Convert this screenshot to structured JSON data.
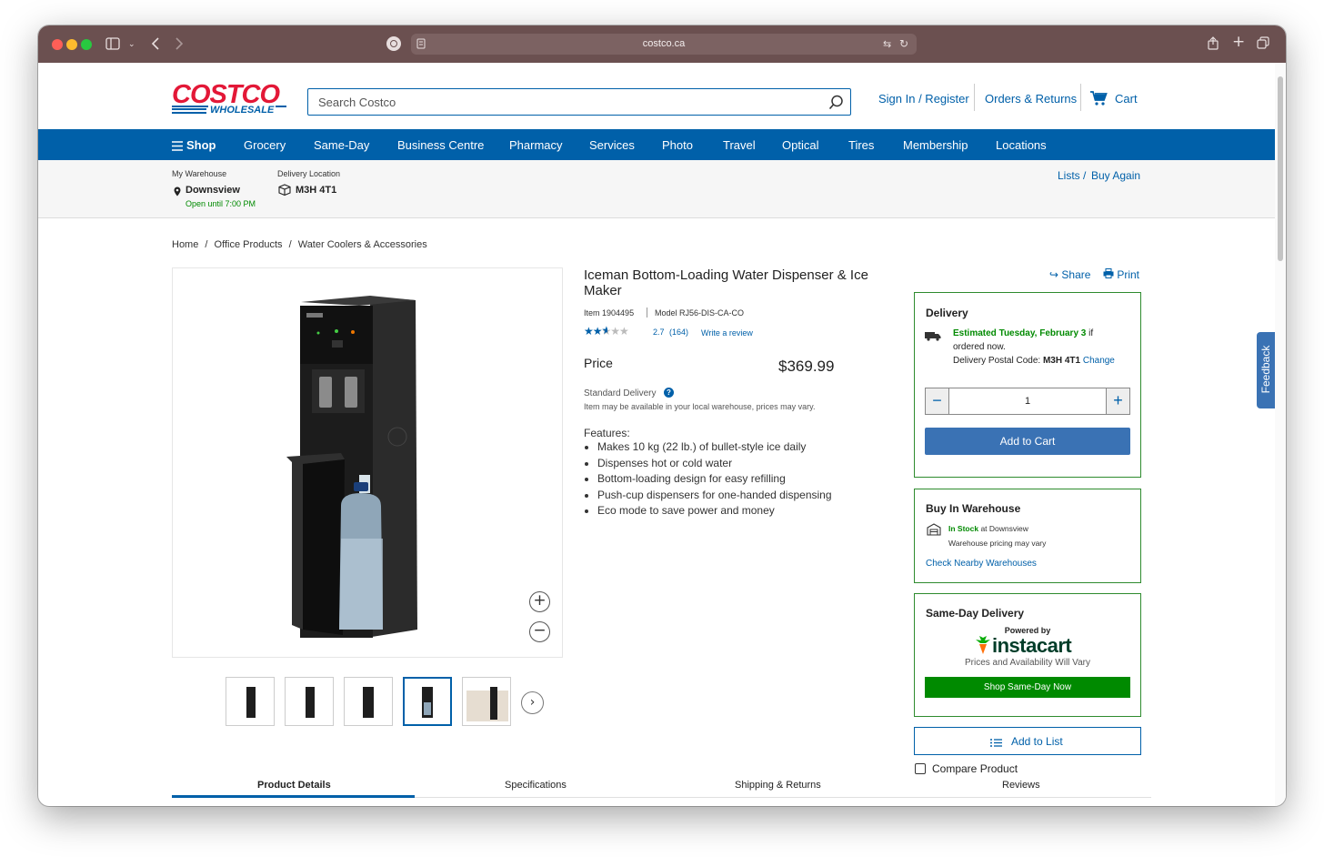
{
  "browser": {
    "url": "costco.ca"
  },
  "header": {
    "logo_top": "COSTCO",
    "logo_bottom": "WHOLESALE",
    "search_placeholder": "Search Costco",
    "sign_in": "Sign In / Register",
    "orders": "Orders & Returns",
    "cart": "Cart"
  },
  "nav": {
    "shop": "Shop",
    "items": [
      "Grocery",
      "Same-Day",
      "Business Centre",
      "Pharmacy",
      "Services",
      "Photo",
      "Travel",
      "Optical",
      "Tires",
      "Membership",
      "Locations"
    ]
  },
  "subheader": {
    "warehouse_label": "My Warehouse",
    "warehouse_name": "Downsview",
    "warehouse_hours": "Open until 7:00 PM",
    "delivery_label": "Delivery Location",
    "delivery_code": "M3H 4T1",
    "lists": "Lists /",
    "buy_again": "Buy Again"
  },
  "breadcrumb": [
    "Home",
    "/",
    "Office Products",
    "/",
    "Water Coolers & Accessories"
  ],
  "product": {
    "title": "Iceman Bottom-Loading Water Dispenser & Ice Maker",
    "item_label": "Item",
    "item_number": "1904495",
    "model_label": "Model",
    "model_number": "RJ56-DIS-CA-CO",
    "rating": 2.7,
    "rating_text": "2.7",
    "review_count": "(164)",
    "write_review": "Write a review",
    "price_label": "Price",
    "price": "$369.99",
    "standard_delivery": "Standard Delivery",
    "availability_note": "Item may be available in your local warehouse, prices may vary.",
    "features_label": "Features:",
    "features": [
      "Makes 10 kg (22 lb.) of bullet-style ice daily",
      "Dispenses hot or cold water",
      "Bottom-loading design for easy refilling",
      "Push-cup dispensers for one-handed dispensing",
      "Eco mode to save power and money"
    ],
    "share": "Share",
    "print": "Print"
  },
  "delivery_box": {
    "title": "Delivery",
    "estimated": "Estimated Tuesday, February 3",
    "estimated_suffix": "if",
    "ordered_now": "ordered now.",
    "postal_label": "Delivery Postal Code:",
    "postal_code": "M3H 4T1",
    "change": "Change",
    "quantity": "1",
    "add_to_cart": "Add to Cart"
  },
  "warehouse_box": {
    "title": "Buy In Warehouse",
    "in_stock": "In Stock",
    "at_location": "at Downsview",
    "pricing_note": "Warehouse pricing may vary",
    "check_nearby": "Check Nearby Warehouses"
  },
  "sameday_box": {
    "title": "Same-Day Delivery",
    "powered_by": "Powered by",
    "brand": "instacart",
    "note": "Prices and Availability Will Vary",
    "button": "Shop Same-Day Now"
  },
  "add_to_list": "Add to List",
  "compare": "Compare Product",
  "tabs": [
    "Product Details",
    "Specifications",
    "Shipping & Returns",
    "Reviews"
  ],
  "feedback": "Feedback",
  "colors": {
    "costco_red": "#e31837",
    "costco_blue": "#0060a9",
    "button_blue": "#3a72b4",
    "green": "#008a00"
  }
}
